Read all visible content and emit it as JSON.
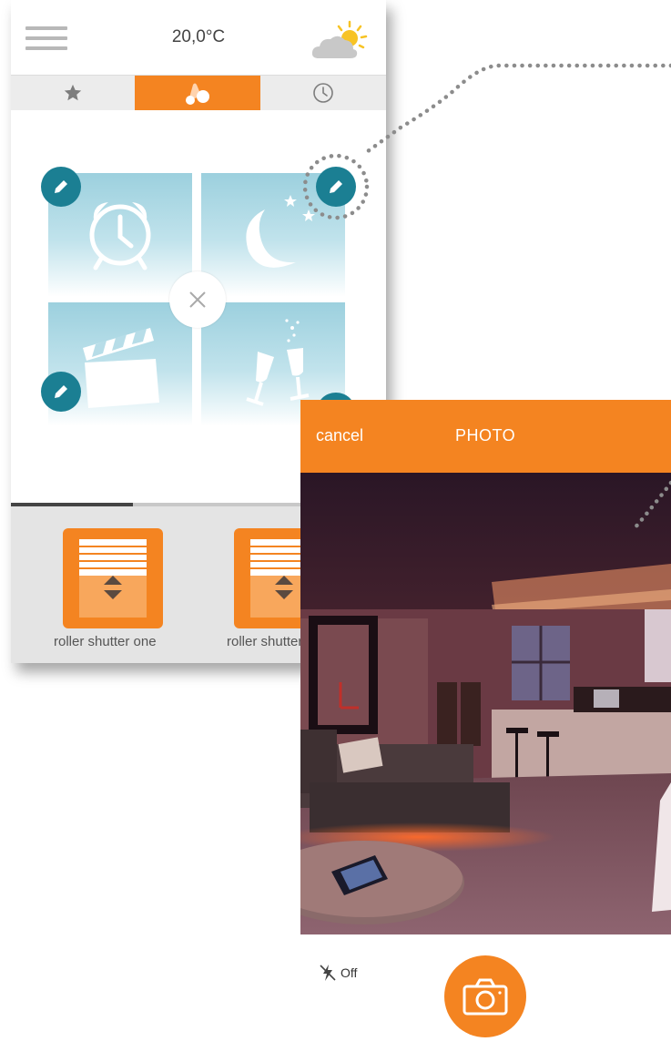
{
  "header": {
    "temperature": "20,0°C",
    "menu_icon": "hamburger-menu-icon",
    "weather_icon": "partly-sunny-icon"
  },
  "tabs": [
    {
      "icon": "star-icon",
      "active": false
    },
    {
      "icon": "scenes-icon",
      "active": true
    },
    {
      "icon": "clock-icon",
      "active": false
    }
  ],
  "scenes": [
    {
      "icon": "alarm-clock-icon"
    },
    {
      "icon": "moon-stars-icon"
    },
    {
      "icon": "clapperboard-icon"
    },
    {
      "icon": "champagne-glasses-icon"
    }
  ],
  "devices": [
    {
      "label": "roller shutter one",
      "icon": "roller-shutter-icon"
    },
    {
      "label": "roller shutter",
      "icon": "roller-shutter-icon"
    }
  ],
  "photo": {
    "cancel_label": "cancel",
    "title": "PHOTO",
    "flash_label": "Off",
    "flash_icon": "flash-off-icon",
    "shutter_icon": "camera-icon"
  },
  "colors": {
    "accent": "#f48421",
    "edit_button": "#1b7f93",
    "tile_sky": "#9cd0de"
  }
}
